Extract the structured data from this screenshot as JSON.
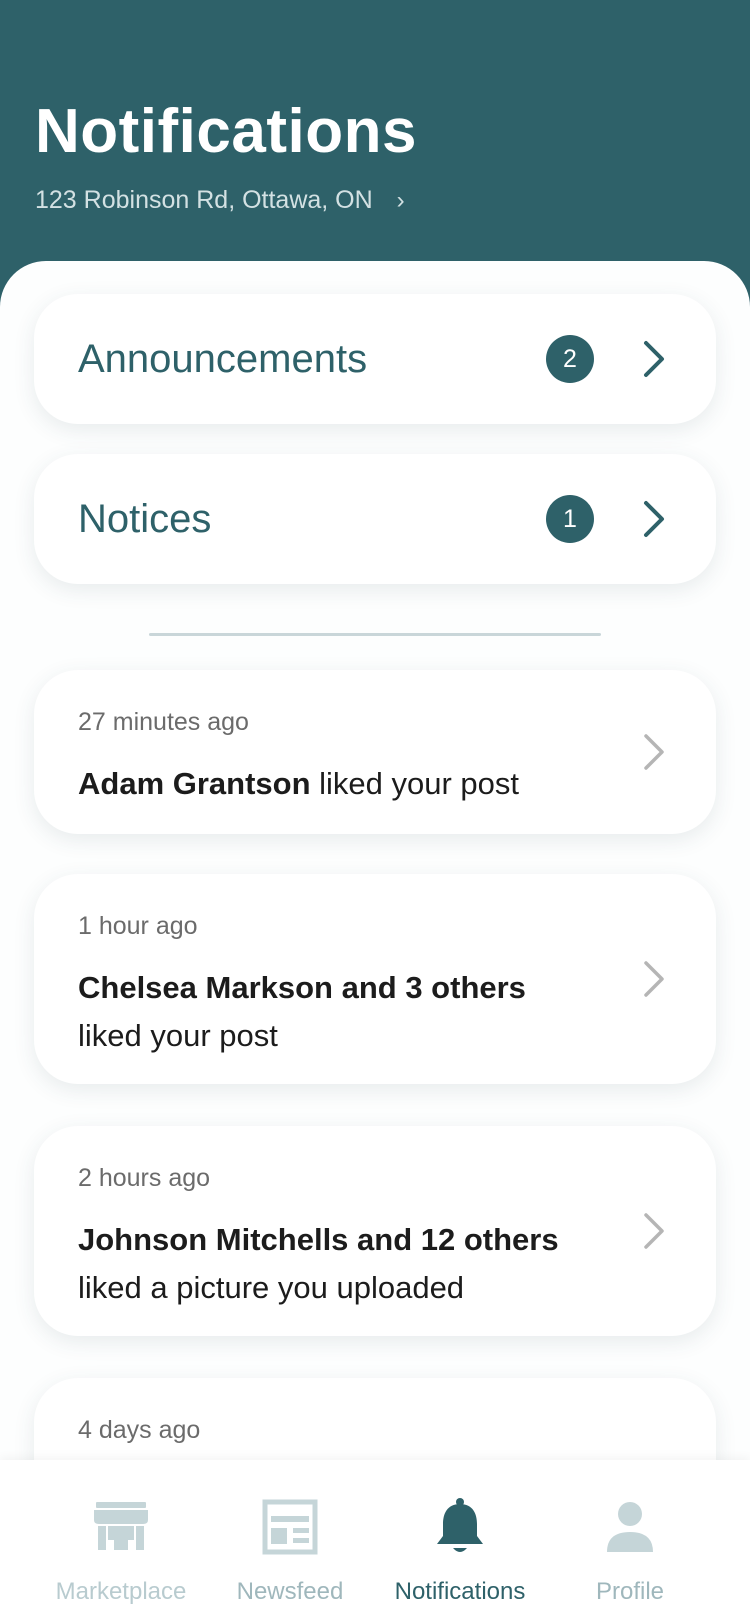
{
  "header": {
    "title": "Notifications",
    "address": "123 Robinson Rd, Ottawa, ON",
    "address_chevron": "›"
  },
  "categories": [
    {
      "label": "Announcements",
      "count": "2"
    },
    {
      "label": "Notices",
      "count": "1"
    }
  ],
  "activity": [
    {
      "time": "27 minutes ago",
      "actor": "Adam Grantson",
      "action": " liked your post"
    },
    {
      "time": "1 hour ago",
      "actor": "Chelsea Markson and 3 others",
      "action": " liked your post"
    },
    {
      "time": "2 hours ago",
      "actor": "Johnson Mitchells and 12 others",
      "action": " liked a picture you uploaded"
    },
    {
      "time": "4 days ago"
    }
  ],
  "tabbar": {
    "items": [
      {
        "label": "Marketplace",
        "icon": "storefront-icon"
      },
      {
        "label": "Newsfeed",
        "icon": "newspaper-icon"
      },
      {
        "label": "Notifications",
        "icon": "bell-icon",
        "active": true
      },
      {
        "label": "Profile",
        "icon": "person-icon"
      }
    ]
  },
  "colors": {
    "header_bg": "#2e6169",
    "accent": "#2e6169",
    "tab_inactive": "#c5d5d8",
    "tab_inactive_label": "#9fb7bc",
    "tab_active": "#2e6169",
    "chevron_gray": "#b0b0b0"
  }
}
